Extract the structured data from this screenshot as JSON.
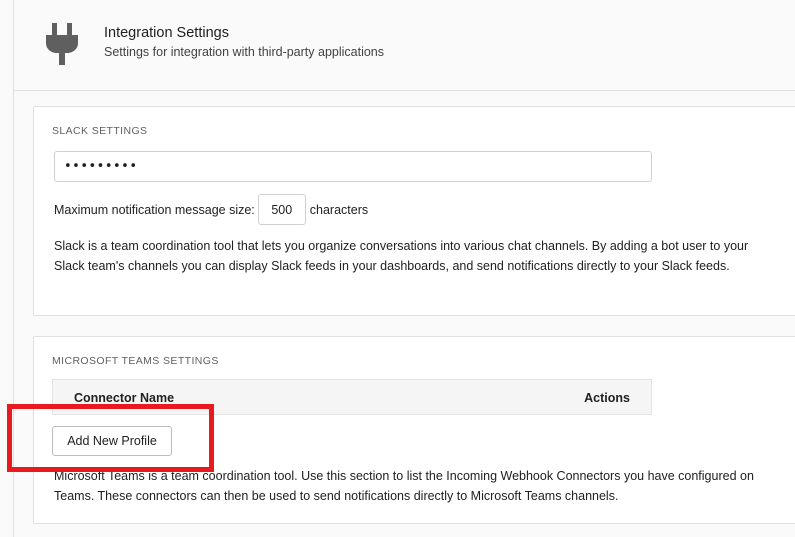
{
  "header": {
    "title": "Integration Settings",
    "subtitle": "Settings for integration with third-party applications",
    "icon": "plug-icon"
  },
  "slack": {
    "section_title": "SLACK SETTINGS",
    "token_value": "•••••••••",
    "max_size_label": "Maximum notification message size:",
    "max_size_value": "500",
    "max_size_unit": "characters",
    "description": "Slack is a team coordination tool that lets you organize conversations into various chat channels. By adding a bot user to your Slack team's channels you can display Slack feeds in your dashboards, and send notifications directly to your Slack feeds."
  },
  "teams": {
    "section_title": "MICROSOFT TEAMS SETTINGS",
    "columns": [
      "Connector Name",
      "Actions"
    ],
    "add_button_label": "Add New Profile",
    "description": "Microsoft Teams is a team coordination tool. Use this section to list the Incoming Webhook Connectors you have configured on Teams. These connectors can then be used to send notifications directly to Microsoft Teams channels."
  },
  "colors": {
    "highlight": "#e8191f",
    "icon": "#5f5f5f"
  }
}
